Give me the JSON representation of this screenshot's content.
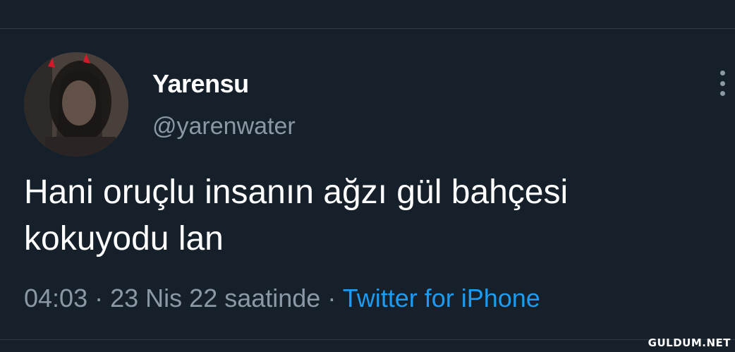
{
  "tweet": {
    "author": {
      "display_name": "Yarensu",
      "handle": "@yarenwater",
      "avatar_icon": "profile-photo"
    },
    "text_line_1": "Hani oruçlu insanın ağzı gül bahçesi",
    "text_line_2": "kokuyodu lan",
    "time": "04:03",
    "separator": "·",
    "date": "23 Nis 22 saatinde",
    "source": "Twitter for iPhone",
    "more_icon": "more-vertical-icon"
  },
  "watermark": "GULDUM.NET",
  "colors": {
    "background": "#15202b",
    "text": "#ffffff",
    "secondary_text": "#8b98a5",
    "link": "#1d9bf0",
    "divider": "#2f3b47"
  }
}
